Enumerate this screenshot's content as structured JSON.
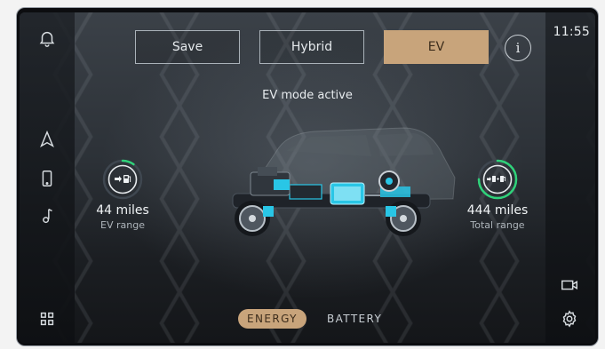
{
  "clock": "11:55",
  "modes": [
    {
      "label": "Save",
      "active": false
    },
    {
      "label": "Hybrid",
      "active": false
    },
    {
      "label": "EV",
      "active": true
    }
  ],
  "info_label": "i",
  "status_text": "EV mode active",
  "ev_range": {
    "value": "44 miles",
    "label": "EV range",
    "fill_fraction": 0.1
  },
  "total_range": {
    "value": "444 miles",
    "label": "Total range",
    "fill_fraction": 0.75
  },
  "tabs": [
    {
      "label": "ENERGY",
      "active": true
    },
    {
      "label": "BATTERY",
      "active": false
    }
  ],
  "colors": {
    "accent": "#c8a47b",
    "gauge_green": "#2fd27a",
    "ev_blue": "#29c6e6"
  },
  "icons": {
    "left": [
      "bell-icon",
      "navigation-icon",
      "phone-icon",
      "music-icon",
      "apps-grid-icon"
    ],
    "right": [
      "camera-icon",
      "settings-icon"
    ]
  }
}
